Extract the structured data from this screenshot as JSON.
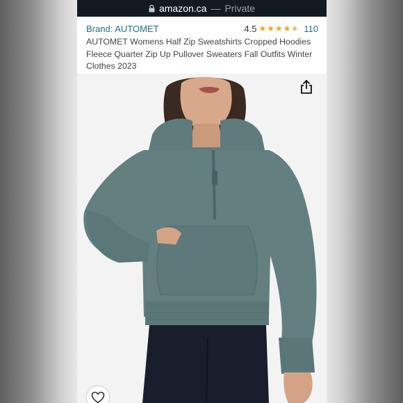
{
  "browser": {
    "domain": "amazon.ca",
    "separator": "—",
    "mode": "Private",
    "icons": [
      "lock-icon"
    ]
  },
  "product": {
    "brand": "Brand: AUTOMET",
    "rating_value": "4.5",
    "rating_stars": 4.5,
    "rating_count": "110",
    "title": "AUTOMET Womens Half Zip Sweatshirts Cropped Hoodies Fleece Quarter Zip Up Pullover Sweaters Fall Outfits Winter Clothes 2023"
  },
  "colors": {
    "brand_link": "#1f6f8b",
    "star": "#f1a31a",
    "url_bar": "#131a22",
    "hoodie": "#637f80"
  },
  "icons": [
    "share-icon",
    "heart-icon",
    "star-icon"
  ]
}
